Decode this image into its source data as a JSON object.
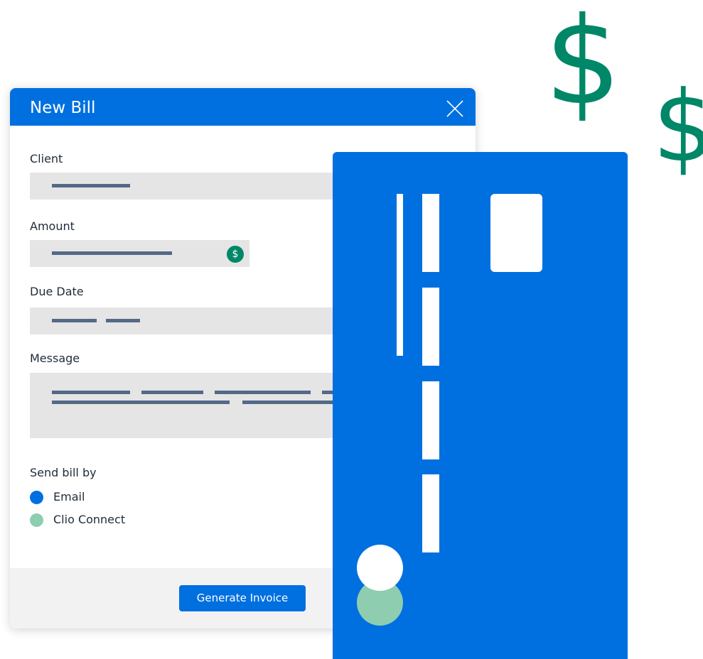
{
  "dialog": {
    "title": "New Bill",
    "fields": {
      "client_label": "Client",
      "amount_label": "Amount",
      "due_date_label": "Due Date",
      "message_label": "Message"
    },
    "amount_icon": "$",
    "send_by": {
      "label": "Send bill by",
      "options": [
        {
          "label": "Email",
          "color": "#0070e0"
        },
        {
          "label": "Clio Connect",
          "color": "#8fcdb0"
        }
      ]
    },
    "generate_button": "Generate Invoice"
  },
  "decor": {
    "dollar_sign": "$"
  },
  "colors": {
    "brand_blue": "#0070e0",
    "accent_green": "#008768",
    "light_green": "#8fcdb0"
  }
}
